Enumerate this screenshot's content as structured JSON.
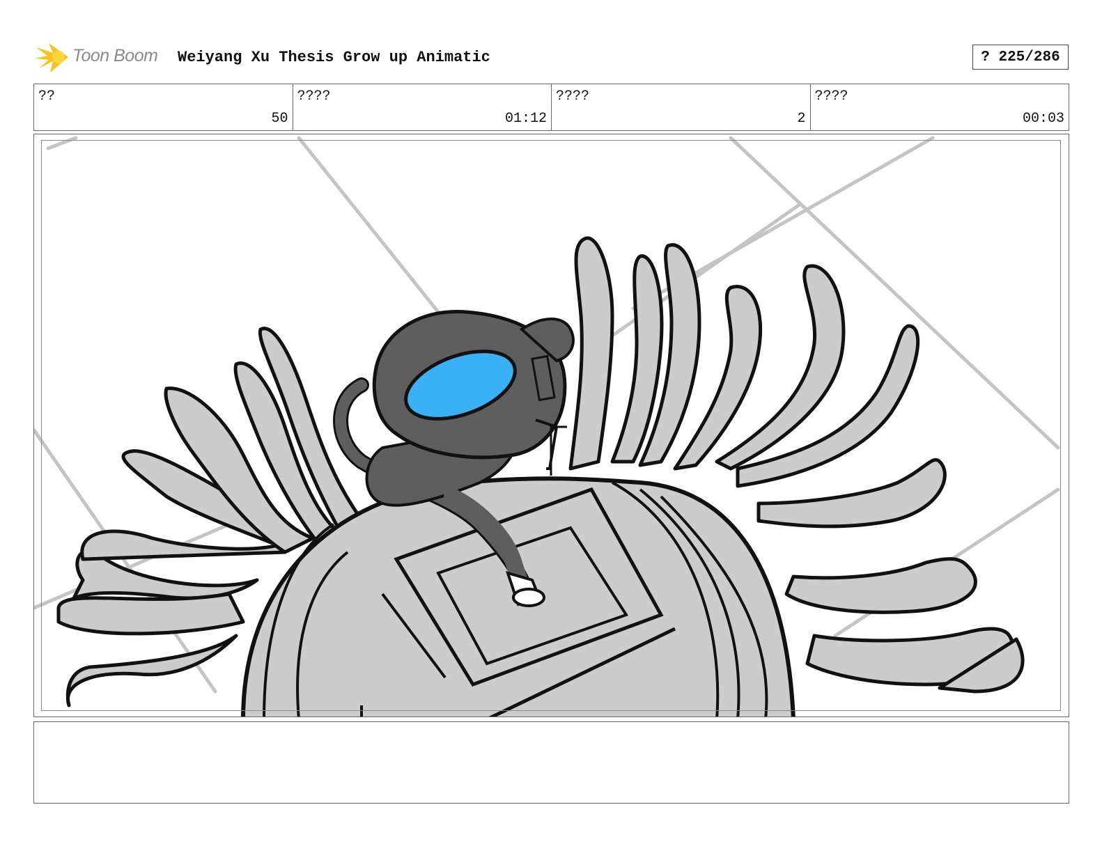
{
  "header": {
    "logo_text": "Toon Boom",
    "title": "Weiyang Xu Thesis Grow up Animatic",
    "page_counter": "? 225/286"
  },
  "info": [
    {
      "label": "??",
      "value": "50"
    },
    {
      "label": "????",
      "value": "01:12"
    },
    {
      "label": "????",
      "value": "2"
    },
    {
      "label": "????",
      "value": "00:03"
    }
  ],
  "panel": {
    "image": "storyboard-sketch-character-on-pressure-pad",
    "colors": {
      "floor": "#ffffff",
      "tile_lines": "#c4c4c4",
      "fill": "#cccccc",
      "character": "#5e5e5e",
      "visor": "#3ab0f5",
      "ink": "#111111"
    }
  },
  "notes": {
    "text": ""
  }
}
